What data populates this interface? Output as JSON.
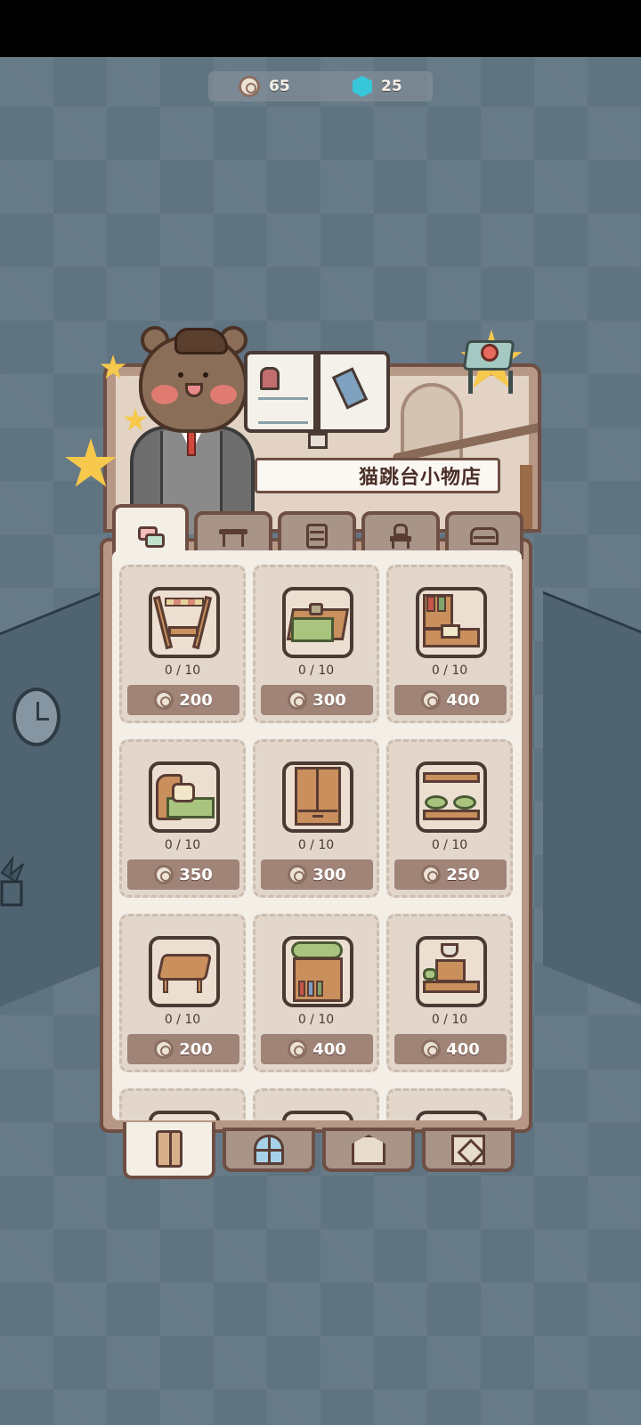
{
  "currency": {
    "coins": "65",
    "gems": "25"
  },
  "shop": {
    "title": "猫跳台小物店"
  },
  "category_tabs": [
    {
      "icon": "cards-icon",
      "active": true
    },
    {
      "icon": "table-icon",
      "active": false
    },
    {
      "icon": "drawer-icon",
      "active": false
    },
    {
      "icon": "chair-icon",
      "active": false
    },
    {
      "icon": "bed-icon",
      "active": false
    }
  ],
  "items": [
    {
      "stock": "0 / 10",
      "price": "200",
      "icon": "swing-chair-icon"
    },
    {
      "stock": "0 / 10",
      "price": "300",
      "icon": "tea-table-icon"
    },
    {
      "stock": "0 / 10",
      "price": "400",
      "icon": "writing-desk-icon"
    },
    {
      "stock": "0 / 10",
      "price": "350",
      "icon": "cat-bed-icon"
    },
    {
      "stock": "0 / 10",
      "price": "300",
      "icon": "wardrobe-icon"
    },
    {
      "stock": "0 / 10",
      "price": "250",
      "icon": "cushion-shelf-icon"
    },
    {
      "stock": "0 / 10",
      "price": "200",
      "icon": "low-table-icon"
    },
    {
      "stock": "0 / 10",
      "price": "400",
      "icon": "plant-bookshelf-icon"
    },
    {
      "stock": "0 / 10",
      "price": "400",
      "icon": "coffee-table-icon"
    }
  ],
  "room_tabs": [
    {
      "icon": "wardrobe-icon",
      "active": true
    },
    {
      "icon": "window-icon",
      "active": false
    },
    {
      "icon": "floor-icon",
      "active": false
    },
    {
      "icon": "wall-icon",
      "active": false
    }
  ],
  "colors": {
    "panel_border": "#6e4f43",
    "panel_bg": "#f3eee6",
    "button_bg": "#a08478",
    "background": "#5f7381"
  }
}
